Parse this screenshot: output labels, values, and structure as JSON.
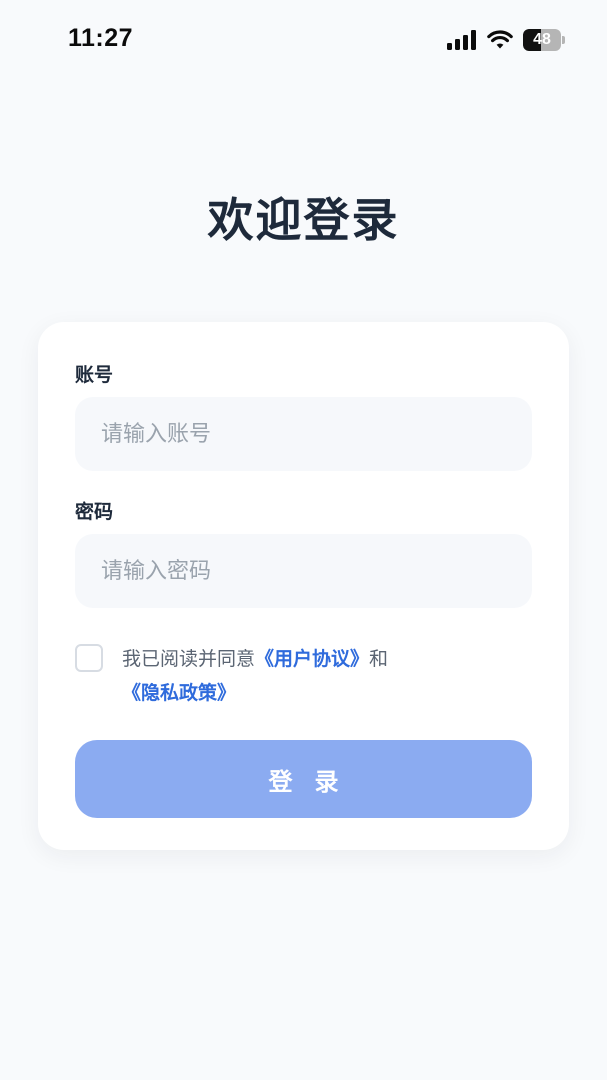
{
  "status_bar": {
    "time": "11:27",
    "battery_level": "48",
    "battery_percent": 48,
    "signal_icon": "cellular-signal-icon",
    "wifi_icon": "wifi-icon"
  },
  "page": {
    "title": "欢迎登录"
  },
  "form": {
    "account_label": "账号",
    "account_placeholder": "请输入账号",
    "account_value": "",
    "password_label": "密码",
    "password_placeholder": "请输入密码",
    "password_value": "",
    "agreement": {
      "checked": false,
      "prefix": "我已阅读并同意",
      "user_agreement": "《用户协议》",
      "conjunction": "和",
      "privacy_policy": "《隐私政策》"
    },
    "login_button": "登录"
  },
  "colors": {
    "background": "#f8fafc",
    "title": "#1e2a3b",
    "link": "#2f6bdc",
    "button": "#8babf1",
    "input_bg": "#f6f8fb"
  }
}
